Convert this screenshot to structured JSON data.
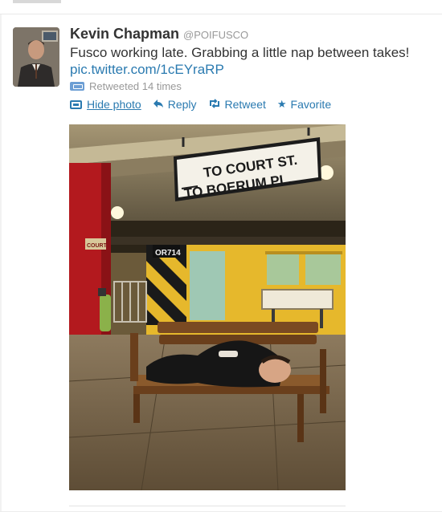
{
  "tweet": {
    "fullname": "Kevin Chapman",
    "handle": "@POIFUSCO",
    "text": "Fusco working late. Grabbing a little nap between takes!",
    "link": "pic.twitter.com/1cEYraRP",
    "retweeted": "Retweeted 14 times"
  },
  "actions": {
    "hide_photo": "Hide photo",
    "reply": "Reply",
    "retweet": "Retweet",
    "favorite": "Favorite"
  },
  "photo": {
    "sign_line1": "TO COURT ST.",
    "sign_line2": "TO BOERUM PL.",
    "car_number": "OR714",
    "pillar_label": "COURT"
  },
  "icons": {
    "reply": "reply-arrow-icon",
    "retweet": "retweet-icon",
    "favorite": "star-icon",
    "hide_photo": "photo-icon",
    "retweeted": "retweet-count-icon"
  },
  "colors": {
    "link": "#2a7ab0",
    "muted": "#999999",
    "text": "#333333"
  }
}
